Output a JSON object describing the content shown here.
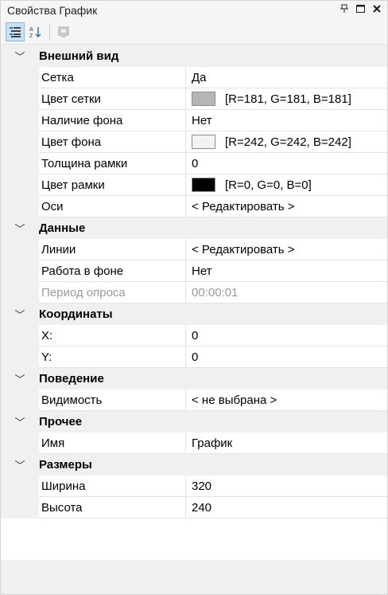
{
  "window": {
    "title": "Свойства График"
  },
  "toolbar": {
    "categorized_icon": "categorized-view-icon",
    "alpha_icon": "sort-alpha-icon",
    "pages_icon": "property-pages-icon"
  },
  "categories": {
    "appearance": {
      "name": "Внешний вид",
      "rows": {
        "grid": {
          "name": "Сетка",
          "value": "Да"
        },
        "grid_color": {
          "name": "Цвет сетки",
          "value": "[R=181, G=181, B=181]",
          "color": "#b5b5b5"
        },
        "has_bg": {
          "name": "Наличие фона",
          "value": "Нет"
        },
        "bg_color": {
          "name": "Цвет фона",
          "value": "[R=242, G=242, B=242]",
          "color": "#f2f2f2"
        },
        "border_width": {
          "name": "Толщина рамки",
          "value": "0"
        },
        "border_color": {
          "name": "Цвет рамки",
          "value": "[R=0, G=0, B=0]",
          "color": "#000000"
        },
        "axes": {
          "name": "Оси",
          "value": "< Редактировать >"
        }
      }
    },
    "data": {
      "name": "Данные",
      "rows": {
        "lines": {
          "name": "Линии",
          "value": "< Редактировать >"
        },
        "background_work": {
          "name": "Работа в фоне",
          "value": "Нет"
        },
        "poll_period": {
          "name": "Период опроса",
          "value": "00:00:01"
        }
      }
    },
    "coords": {
      "name": "Координаты",
      "rows": {
        "x": {
          "name": "X:",
          "value": "0"
        },
        "y": {
          "name": "Y:",
          "value": "0"
        }
      }
    },
    "behavior": {
      "name": "Поведение",
      "rows": {
        "visibility": {
          "name": "Видимость",
          "value": "< не выбрана >"
        }
      }
    },
    "other": {
      "name": "Прочее",
      "rows": {
        "name": {
          "name": "Имя",
          "value": "График"
        }
      }
    },
    "sizes": {
      "name": "Размеры",
      "rows": {
        "width": {
          "name": "Ширина",
          "value": "320"
        },
        "height": {
          "name": "Высота",
          "value": "240"
        }
      }
    }
  }
}
